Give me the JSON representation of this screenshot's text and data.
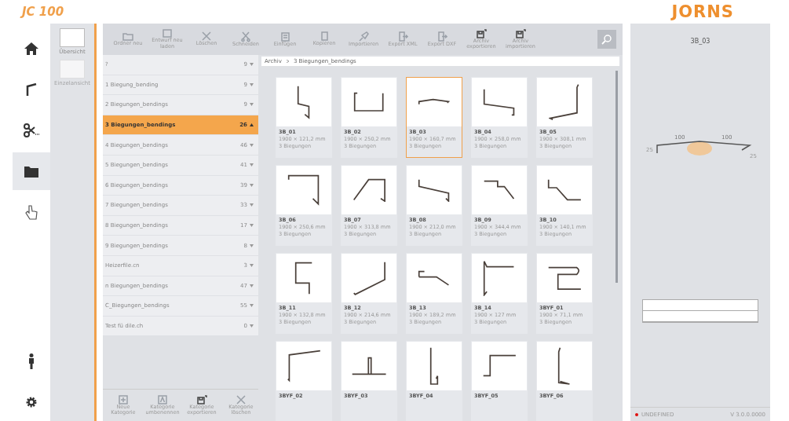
{
  "header": {
    "product": "JC 100",
    "brand": "JORNS"
  },
  "nav": [
    {
      "kind": "home",
      "selected": false
    },
    {
      "kind": "bend",
      "selected": false
    },
    {
      "kind": "cut",
      "selected": false
    },
    {
      "kind": "folder",
      "selected": true
    },
    {
      "kind": "hand",
      "selected": false
    },
    {
      "kind": "person",
      "selected": false
    },
    {
      "kind": "gear",
      "selected": false
    }
  ],
  "views": [
    {
      "label": "Übersicht",
      "selected": true
    },
    {
      "label": "Einzelansicht",
      "selected": false
    }
  ],
  "toolbar": [
    {
      "label": "Ordner neu",
      "kind": "folder"
    },
    {
      "label": "Entwurf neu laden",
      "kind": "reload"
    },
    {
      "label": "Löschen",
      "kind": "delete"
    },
    {
      "label": "Schneiden",
      "kind": "cut"
    },
    {
      "label": "Einfügen",
      "kind": "paste"
    },
    {
      "label": "Kopieren",
      "kind": "copy"
    },
    {
      "label": "Importieren",
      "kind": "import"
    },
    {
      "label": "Export XML",
      "kind": "export"
    },
    {
      "label": "Export DXF",
      "kind": "export"
    },
    {
      "label": "Archiv exportieren",
      "kind": "archive"
    },
    {
      "label": "Archiv importieren",
      "kind": "archive"
    }
  ],
  "categories": [
    {
      "name": "?",
      "count": "9",
      "selected": false
    },
    {
      "name": "1 Biegung_bending",
      "count": "9",
      "selected": false
    },
    {
      "name": "2 Biegungen_bendings",
      "count": "9",
      "selected": false
    },
    {
      "name": "3 Biegungen_bendings",
      "count": "26",
      "selected": true
    },
    {
      "name": "4 Biegungen_bendings",
      "count": "46",
      "selected": false
    },
    {
      "name": "5 Biegungen_bendings",
      "count": "41",
      "selected": false
    },
    {
      "name": "6 Biegungen_bendings",
      "count": "39",
      "selected": false
    },
    {
      "name": "7 Biegungen_bendings",
      "count": "33",
      "selected": false
    },
    {
      "name": "8 Biegungen_bendings",
      "count": "17",
      "selected": false
    },
    {
      "name": "9 Biegungen_bendings",
      "count": "8",
      "selected": false
    },
    {
      "name": "Heizerfile.cn",
      "count": "3",
      "selected": false
    },
    {
      "name": "n Biegungen_bendings",
      "count": "47",
      "selected": false
    },
    {
      "name": "C_Biegungen_bendings",
      "count": "55",
      "selected": false
    },
    {
      "name": "Test fü dile.ch",
      "count": "0",
      "selected": false
    }
  ],
  "category_actions": [
    {
      "label": "Neue Kategorie",
      "kind": "add"
    },
    {
      "label": "Kategorie umbenennen",
      "kind": "rename"
    },
    {
      "label": "Kategorie exportieren",
      "kind": "archive"
    },
    {
      "label": "Kategorie löschen",
      "kind": "delete"
    }
  ],
  "breadcrumb": [
    "Archiv",
    "3 Biegungen_bendings"
  ],
  "profiles": [
    {
      "name": "3B_01",
      "size": "1900 × 121,2 mm",
      "bends": "3 Biegungen",
      "selected": false
    },
    {
      "name": "3B_02",
      "size": "1900 × 250,2 mm",
      "bends": "3 Biegungen",
      "selected": false
    },
    {
      "name": "3B_03",
      "size": "1900 × 160,7 mm",
      "bends": "3 Biegungen",
      "selected": true
    },
    {
      "name": "3B_04",
      "size": "1900 × 258,0 mm",
      "bends": "3 Biegungen",
      "selected": false
    },
    {
      "name": "3B_05",
      "size": "1900 × 308,1 mm",
      "bends": "3 Biegungen",
      "selected": false
    },
    {
      "name": "3B_06",
      "size": "1900 × 250,6 mm",
      "bends": "3 Biegungen",
      "selected": false
    },
    {
      "name": "3B_07",
      "size": "1900 × 313,8 mm",
      "bends": "3 Biegungen",
      "selected": false
    },
    {
      "name": "3B_08",
      "size": "1900 × 212,0 mm",
      "bends": "3 Biegungen",
      "selected": false
    },
    {
      "name": "3B_09",
      "size": "1900 × 344,4 mm",
      "bends": "3 Biegungen",
      "selected": false
    },
    {
      "name": "3B_10",
      "size": "1900 × 140,1 mm",
      "bends": "3 Biegungen",
      "selected": false
    },
    {
      "name": "3B_11",
      "size": "1900 × 132,8 mm",
      "bends": "3 Biegungen",
      "selected": false
    },
    {
      "name": "3B_12",
      "size": "1900 × 214,6 mm",
      "bends": "3 Biegungen",
      "selected": false
    },
    {
      "name": "3B_13",
      "size": "1900 × 189,2 mm",
      "bends": "3 Biegungen",
      "selected": false
    },
    {
      "name": "3B_14",
      "size": "1900 × 127 mm",
      "bends": "3 Biegungen",
      "selected": false
    },
    {
      "name": "3BYF_01",
      "size": "1900 × 71,1 mm",
      "bends": "3 Biegungen",
      "selected": false
    },
    {
      "name": "3BYF_02",
      "selected": false
    },
    {
      "name": "3BYF_03",
      "selected": false
    },
    {
      "name": "3BYF_04",
      "selected": false
    },
    {
      "name": "3BYF_05",
      "selected": false
    },
    {
      "name": "3BYF_06",
      "selected": false
    }
  ],
  "detail": {
    "title": "3B_03",
    "dims": [
      "100",
      "100"
    ],
    "left_label": "25",
    "right_label": "25"
  },
  "status": {
    "connection": "UNDEFINED",
    "version": "V 3.0.0.0000"
  }
}
